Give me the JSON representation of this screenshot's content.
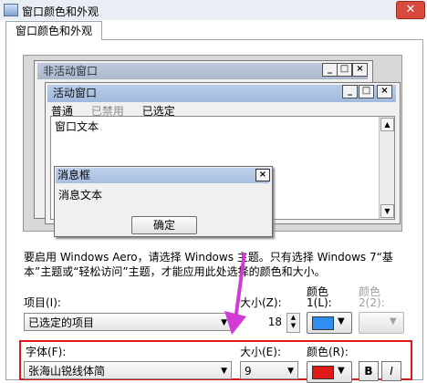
{
  "window": {
    "title": "窗口颜色和外观",
    "close_label": "✕"
  },
  "tab": {
    "label": "窗口颜色和外观"
  },
  "preview": {
    "inactive_title": "非活动窗口",
    "active_title": "活动窗口",
    "menu": {
      "normal": "普通",
      "disabled": "已禁用",
      "selected": "已选定"
    },
    "window_text": "窗口文本",
    "msgbox_title": "消息框",
    "msgbox_text": "消息文本",
    "ok_label": "确定",
    "controls": {
      "minimize": "_",
      "maximize": "□",
      "close": "×"
    }
  },
  "description": "要启用 Windows Aero，请选择 Windows 主题。只有选择 Windows 7“基本”主题或“轻松访问”主题，才能应用此处选择的颜色和大小。",
  "item_row": {
    "item_label": "项目(I):",
    "item_value": "已选定的项目",
    "size_label": "大小(Z):",
    "size_value": "18",
    "color1_label": "颜色",
    "color1_sublabel": "1(L):",
    "color2_label": "颜色",
    "color2_sublabel": "2(2):",
    "color1": "#2e8ff0"
  },
  "font_row": {
    "font_label": "字体(F):",
    "font_value": "张海山锐线体简",
    "size_label": "大小(E):",
    "size_value": "9",
    "color_label": "颜色(R):",
    "color": "#e01818",
    "bold_label": "B",
    "italic_label": "I"
  },
  "icons": {
    "dropdown": "dropdown-arrow-icon",
    "pointer": "pink-arrow"
  }
}
